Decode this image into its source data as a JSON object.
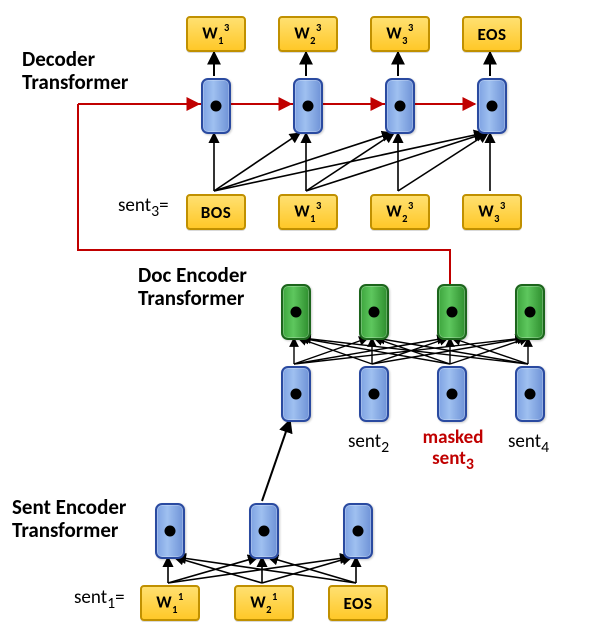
{
  "labels": {
    "decoder": "Decoder\nTransformer",
    "docenc": "Doc Encoder\nTransformer",
    "sentenc": "Sent Encoder\nTransformer",
    "sent1": "sent",
    "sent1_sub": "1",
    "sent1_eq": "=",
    "sent3": "sent",
    "sent3_sub": "3",
    "sent3_eq": "=",
    "sent2": "sent",
    "sent2_sub": "2",
    "sent4": "sent",
    "sent4_sub": "4",
    "masked_line1": "masked",
    "masked_line2": "sent",
    "masked_line2_sub": "3"
  },
  "tokens": {
    "bottom": [
      "W",
      "W",
      "EOS"
    ],
    "bottom_sub": [
      "1",
      "2",
      ""
    ],
    "bottom_sup": [
      "1",
      "1",
      ""
    ],
    "mid_in": [
      "BOS",
      "W",
      "W",
      "W"
    ],
    "mid_in_sub": [
      "",
      "1",
      "2",
      "3"
    ],
    "mid_in_sup": [
      "",
      "3",
      "3",
      "3"
    ],
    "top_out": [
      "W",
      "W",
      "W",
      "EOS"
    ],
    "top_out_sub": [
      "1",
      "2",
      "3",
      ""
    ],
    "top_out_sup": [
      "3",
      "3",
      "3",
      ""
    ]
  },
  "chart_data": {
    "type": "diagram",
    "title": "Hierarchical document-level Transformer with masked sentence reconstruction",
    "components": [
      {
        "name": "Sent Encoder Transformer",
        "inputs": [
          "sent1 = W1^1, W2^1, EOS"
        ],
        "outputs": [
          "sentence embedding for sent1"
        ],
        "position": "bottom"
      },
      {
        "name": "Doc Encoder Transformer",
        "inputs": [
          "sent1 embedding",
          "sent2",
          "masked sent3",
          "sent4"
        ],
        "outputs": [
          "contextualized sentence embeddings (4)"
        ],
        "position": "middle"
      },
      {
        "name": "Decoder Transformer",
        "inputs": [
          "BOS, W1^3, W2^3, W3^3 (shifted sent3)",
          "doc-encoder output for sent3 position"
        ],
        "outputs": [
          "W1^3, W2^3, W3^3, EOS"
        ],
        "position": "top"
      }
    ],
    "edges": [
      {
        "from": "sent1 tokens",
        "to": "Sent Encoder capsules",
        "attention": "full (3x3)"
      },
      {
        "from": "Sent Encoder output",
        "to": "Doc Encoder input slot 1"
      },
      {
        "from": "Doc Encoder lower capsules",
        "to": "Doc Encoder upper (green) capsules",
        "attention": "full (4x4)"
      },
      {
        "from": "Doc Encoder green capsule 3 (masked sent3)",
        "to": "each Decoder capsule",
        "style": "red cross-attention"
      },
      {
        "from": "sent3 input tokens",
        "to": "Decoder capsules",
        "attention": "causal (triangular)"
      },
      {
        "from": "Decoder capsules",
        "to": "output tokens W1^3..EOS"
      }
    ],
    "masked_position": "sent3",
    "decoder_attention": "causal",
    "encoder_attention": "full",
    "sequence_lengths": {
      "sent_encoder": 3,
      "doc_encoder": 4,
      "decoder": 4
    }
  }
}
